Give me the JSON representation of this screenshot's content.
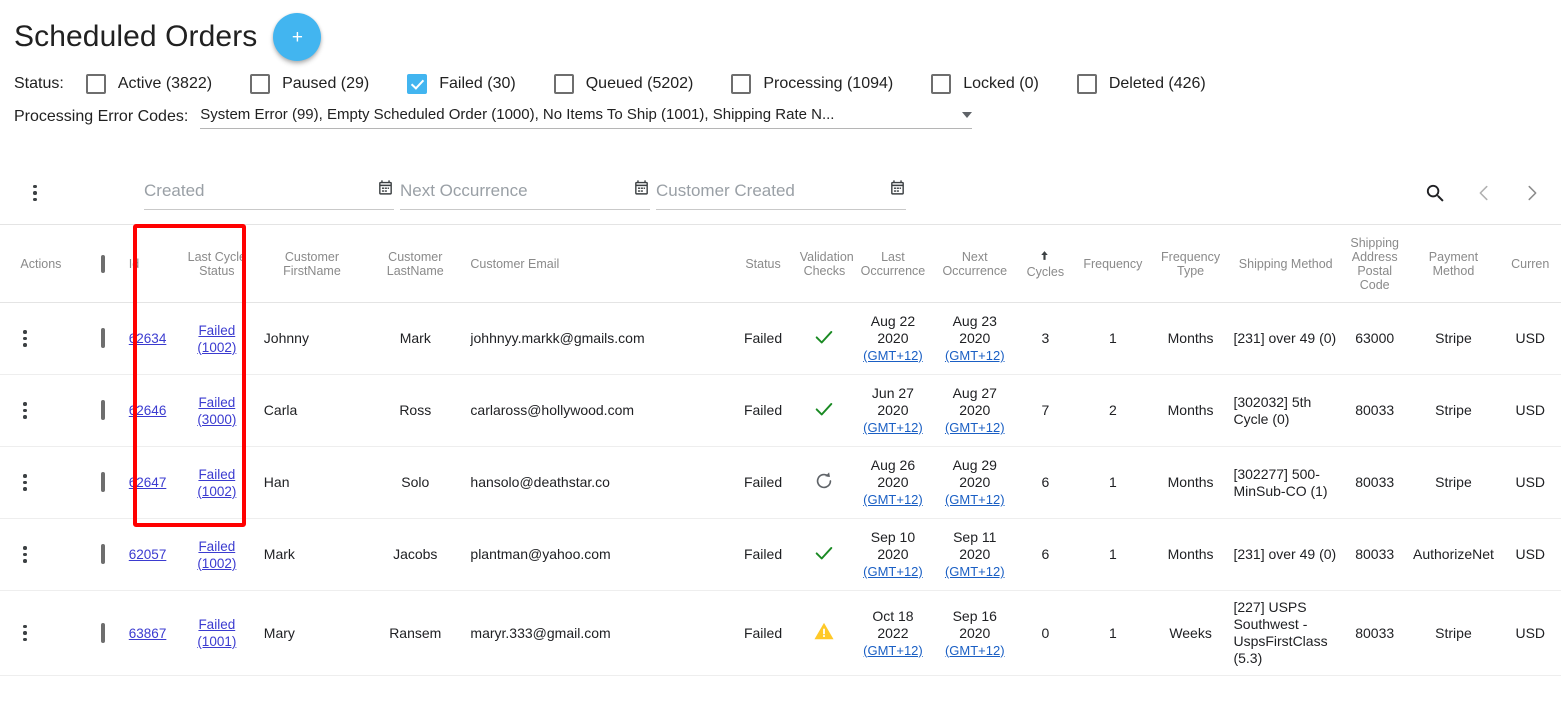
{
  "header": {
    "title": "Scheduled Orders",
    "add_button_label": "+",
    "add_button_icon": "plus-icon",
    "accent_color": "#42b5f0"
  },
  "filters": {
    "status_label": "Status:",
    "status_options": [
      {
        "label": "Active (3822)",
        "checked": false
      },
      {
        "label": "Paused (29)",
        "checked": false
      },
      {
        "label": "Failed (30)",
        "checked": true
      },
      {
        "label": "Queued (5202)",
        "checked": false
      },
      {
        "label": "Processing (1094)",
        "checked": false
      },
      {
        "label": "Locked (0)",
        "checked": false
      },
      {
        "label": "Deleted (426)",
        "checked": false
      }
    ],
    "error_codes_label": "Processing Error Codes:",
    "error_codes_value": "System Error (99), Empty Scheduled Order (1000), No Items To Ship (1001), Shipping Rate N...",
    "error_codes_caret_icon": "chevron-down-icon"
  },
  "toolbar": {
    "menu_icon": "kebab-menu-icon",
    "date_filters": [
      {
        "placeholder": "Created",
        "value": "",
        "icon": "calendar-icon"
      },
      {
        "placeholder": "Next Occurrence",
        "value": "",
        "icon": "calendar-icon"
      },
      {
        "placeholder": "Customer Created",
        "value": "",
        "icon": "calendar-icon"
      }
    ],
    "search_icon": "search-icon",
    "prev_icon": "chevron-left-icon",
    "next_icon": "chevron-right-icon"
  },
  "table": {
    "columns": [
      {
        "key": "actions",
        "label": "Actions"
      },
      {
        "key": "select",
        "label": ""
      },
      {
        "key": "id",
        "label": "Id"
      },
      {
        "key": "last_cycle_status",
        "label": "Last Cycle Status"
      },
      {
        "key": "customer_firstname",
        "label": "Customer FirstName"
      },
      {
        "key": "customer_lastname",
        "label": "Customer LastName"
      },
      {
        "key": "customer_email",
        "label": "Customer Email"
      },
      {
        "key": "status",
        "label": "Status"
      },
      {
        "key": "validation_checks",
        "label": "Validation Checks"
      },
      {
        "key": "last_occurrence",
        "label": "Last Occurrence"
      },
      {
        "key": "next_occurrence",
        "label": "Next Occurrence"
      },
      {
        "key": "cycles",
        "label": "Cycles",
        "sorted": "asc"
      },
      {
        "key": "frequency",
        "label": "Frequency"
      },
      {
        "key": "frequency_type",
        "label": "Frequency Type"
      },
      {
        "key": "shipping_method",
        "label": "Shipping Method"
      },
      {
        "key": "shipping_postal_code",
        "label": "Shipping Address Postal Code"
      },
      {
        "key": "payment_method",
        "label": "Payment Method"
      },
      {
        "key": "currency",
        "label": "Curren"
      }
    ],
    "gmt_link_label": "(GMT+12)",
    "rows": [
      {
        "actions_icon": "kebab-menu-icon",
        "selected": false,
        "id": "62634",
        "lcs_label": "Failed",
        "lcs_code": "(1002)",
        "customer_firstname": "Johnny",
        "customer_lastname": "Mark",
        "customer_email": "johhnyy.markk@gmails.com",
        "status": "Failed",
        "validation_icon": "check-icon",
        "last_occurrence": "Aug 22 2020",
        "next_occurrence": "Aug 23 2020",
        "cycles": "3",
        "frequency": "1",
        "frequency_type": "Months",
        "shipping_method": "[231] over 49 (0)",
        "shipping_postal_code": "63000",
        "payment_method": "Stripe",
        "currency": "USD"
      },
      {
        "actions_icon": "kebab-menu-icon",
        "selected": false,
        "id": "62646",
        "lcs_label": "Failed",
        "lcs_code": "(3000)",
        "customer_firstname": "Carla",
        "customer_lastname": "Ross",
        "customer_email": "carlaross@hollywood.com",
        "status": "Failed",
        "validation_icon": "check-icon",
        "last_occurrence": "Jun 27 2020",
        "next_occurrence": "Aug 27 2020",
        "cycles": "7",
        "frequency": "2",
        "frequency_type": "Months",
        "shipping_method": "[302032] 5th Cycle (0)",
        "shipping_postal_code": "80033",
        "payment_method": "Stripe",
        "currency": "USD"
      },
      {
        "actions_icon": "kebab-menu-icon",
        "selected": false,
        "id": "62647",
        "lcs_label": "Failed",
        "lcs_code": "(1002)",
        "customer_firstname": "Han",
        "customer_lastname": "Solo",
        "customer_email": "hansolo@deathstar.co",
        "status": "Failed",
        "validation_icon": "refresh-icon",
        "last_occurrence": "Aug 26 2020",
        "next_occurrence": "Aug 29 2020",
        "cycles": "6",
        "frequency": "1",
        "frequency_type": "Months",
        "shipping_method": "[302277] 500-MinSub-CO (1)",
        "shipping_postal_code": "80033",
        "payment_method": "Stripe",
        "currency": "USD"
      },
      {
        "actions_icon": "kebab-menu-icon",
        "selected": false,
        "id": "62057",
        "lcs_label": "Failed",
        "lcs_code": "(1002)",
        "customer_firstname": "Mark",
        "customer_lastname": "Jacobs",
        "customer_email": "plantman@yahoo.com",
        "status": "Failed",
        "validation_icon": "check-icon",
        "last_occurrence": "Sep 10 2020",
        "next_occurrence": "Sep 11 2020",
        "cycles": "6",
        "frequency": "1",
        "frequency_type": "Months",
        "shipping_method": "[231] over 49 (0)",
        "shipping_postal_code": "80033",
        "payment_method": "AuthorizeNet",
        "currency": "USD"
      },
      {
        "actions_icon": "kebab-menu-icon",
        "selected": false,
        "id": "63867",
        "lcs_label": "Failed",
        "lcs_code": "(1001)",
        "customer_firstname": "Mary",
        "customer_lastname": "Ransem",
        "customer_email": "maryr.333@gmail.com",
        "status": "Failed",
        "validation_icon": "warning-icon",
        "last_occurrence": "Oct 18 2022",
        "next_occurrence": "Sep 16 2020",
        "cycles": "0",
        "frequency": "1",
        "frequency_type": "Weeks",
        "shipping_method": "[227] USPS Southwest - UspsFirstClass (5.3)",
        "shipping_postal_code": "80033",
        "payment_method": "Stripe",
        "currency": "USD"
      }
    ]
  },
  "annotation": {
    "highlight_color": "#ff0000",
    "highlight_target": "last-cycle-status-column"
  }
}
